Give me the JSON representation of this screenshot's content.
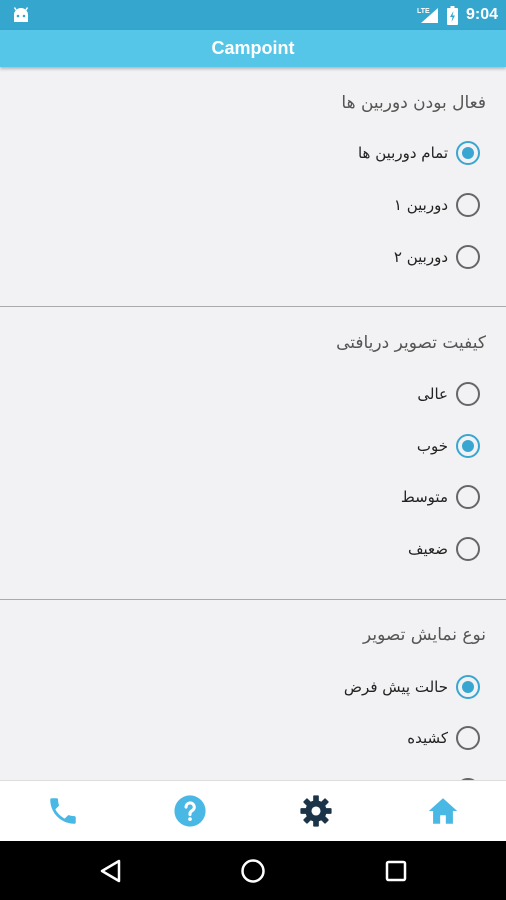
{
  "status_bar": {
    "time": "9:04",
    "icons": [
      "android-icon",
      "lte-signal-icon",
      "battery-icon"
    ],
    "color": "#35a7cf"
  },
  "app_bar": {
    "title": "Campoint",
    "color": "#55c6e8"
  },
  "sections": [
    {
      "title": "فعال بودن دوربین ها",
      "options": [
        {
          "label": "تمام دوربین ها",
          "checked": true
        },
        {
          "label": "دوربین ۱",
          "checked": false
        },
        {
          "label": "دوربین ۲",
          "checked": false
        }
      ]
    },
    {
      "title": "کیفیت تصویر دریافتی",
      "options": [
        {
          "label": "عالی",
          "checked": false
        },
        {
          "label": "خوب",
          "checked": true
        },
        {
          "label": "متوسط",
          "checked": false
        },
        {
          "label": "ضعیف",
          "checked": false
        }
      ]
    },
    {
      "title": "نوع نمایش تصویر",
      "options": [
        {
          "label": "حالت پیش فرض",
          "checked": true
        },
        {
          "label": "کشیده",
          "checked": false
        }
      ]
    }
  ],
  "bottom_nav": {
    "items": [
      {
        "icon": "phone-icon",
        "color": "#4ab8e4"
      },
      {
        "icon": "help-icon",
        "color": "#4ab8e4"
      },
      {
        "icon": "settings-gear-icon",
        "color": "#1b3448",
        "active": true
      },
      {
        "icon": "home-icon",
        "color": "#4ab8e4"
      }
    ]
  },
  "system_nav": [
    "back-icon",
    "home-circle-icon",
    "recents-icon"
  ],
  "accent_color": "#39a6d1"
}
